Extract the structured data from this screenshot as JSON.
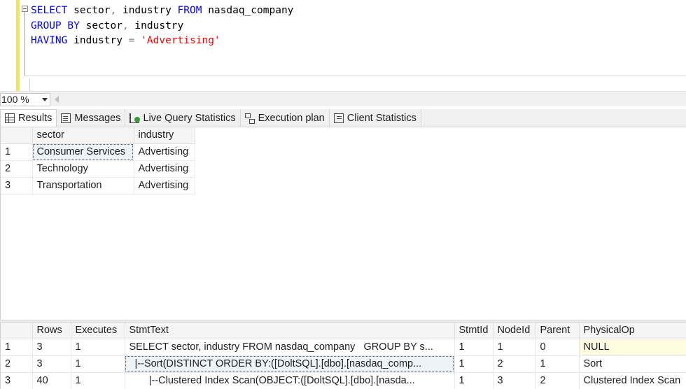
{
  "editor": {
    "lines": [
      [
        {
          "t": "SELECT",
          "c": "kw"
        },
        {
          "t": " sector",
          "c": "plain"
        },
        {
          "t": ",",
          "c": "gray"
        },
        {
          "t": " industry ",
          "c": "plain"
        },
        {
          "t": "FROM",
          "c": "kw"
        },
        {
          "t": " nasdaq_company",
          "c": "plain"
        }
      ],
      [
        {
          "t": "GROUP",
          "c": "kw"
        },
        {
          "t": " ",
          "c": "plain"
        },
        {
          "t": "BY",
          "c": "kw"
        },
        {
          "t": " sector",
          "c": "plain"
        },
        {
          "t": ",",
          "c": "gray"
        },
        {
          "t": " industry",
          "c": "plain"
        }
      ],
      [
        {
          "t": "HAVING",
          "c": "kw"
        },
        {
          "t": " industry ",
          "c": "plain"
        },
        {
          "t": "=",
          "c": "gray"
        },
        {
          "t": " ",
          "c": "plain"
        },
        {
          "t": "'Advertising'",
          "c": "str"
        }
      ]
    ]
  },
  "zoom": {
    "value": "100 %"
  },
  "tabs": [
    {
      "label": "Results",
      "icon": "grid-icon",
      "active": true
    },
    {
      "label": "Messages",
      "icon": "messages-icon",
      "active": false
    },
    {
      "label": "Live Query Statistics",
      "icon": "live-stats-icon",
      "active": false
    },
    {
      "label": "Execution plan",
      "icon": "execution-plan-icon",
      "active": false
    },
    {
      "label": "Client Statistics",
      "icon": "client-stats-icon",
      "active": false
    }
  ],
  "results": {
    "columns": [
      "sector",
      "industry"
    ],
    "rows": [
      [
        "1",
        "Consumer Services",
        "Advertising"
      ],
      [
        "2",
        "Technology",
        "Advertising"
      ],
      [
        "3",
        "Transportation",
        "Advertising"
      ]
    ]
  },
  "stats": {
    "columns": [
      "Rows",
      "Executes",
      "StmtText",
      "StmtId",
      "NodeId",
      "Parent",
      "PhysicalOp"
    ],
    "rows": [
      [
        "1",
        "3",
        "1",
        "SELECT sector, industry FROM nasdaq_company   GROUP BY s...",
        "1",
        "1",
        "0",
        "NULL"
      ],
      [
        "2",
        "3",
        "1",
        "  |--Sort(DISTINCT ORDER BY:([DoltSQL].[dbo].[nasdaq_comp...",
        "1",
        "2",
        "1",
        "Sort"
      ],
      [
        "3",
        "40",
        "1",
        "       |--Clustered Index Scan(OBJECT:([DoltSQL].[dbo].[nasda...",
        "1",
        "3",
        "2",
        "Clustered Index Scan"
      ]
    ]
  },
  "colors": {
    "keyword": "#0000ff",
    "string": "#ff0000",
    "operator": "#808080",
    "margin": "#f5e64f",
    "null_cell": "#fffde1"
  }
}
